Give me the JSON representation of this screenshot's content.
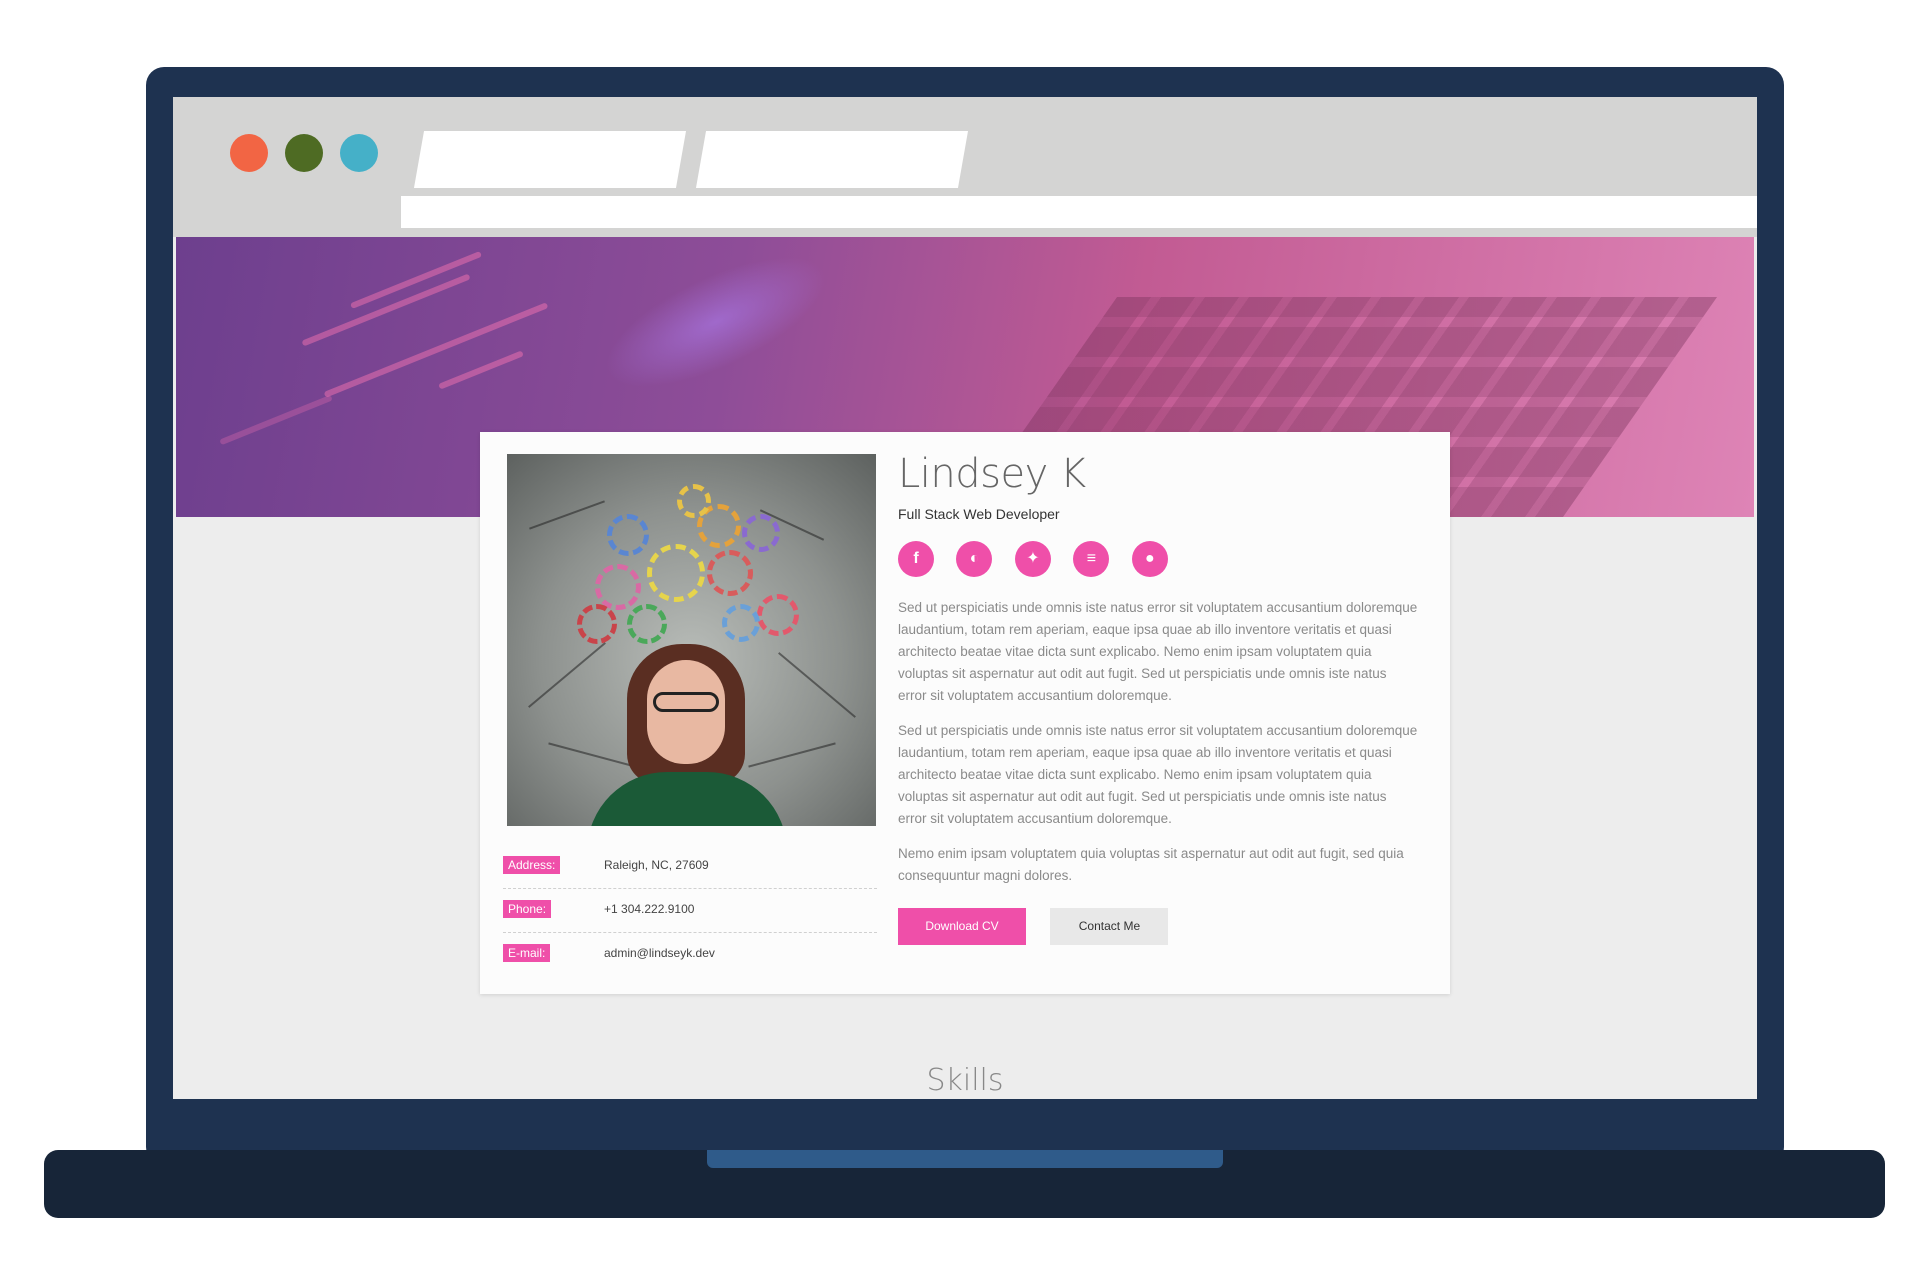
{
  "browser": {
    "window_controls": {
      "close_color": "#f26544",
      "minimize_color": "#4e6b23",
      "maximize_color": "#45b0c8"
    },
    "tabs": [
      "",
      ""
    ],
    "address": ""
  },
  "profile": {
    "name": "Lindsey K",
    "title": "Full Stack Web Developer",
    "photo_icon": "woman-thinking-gears-photo",
    "social_links": [
      {
        "icon": "facebook-icon",
        "glyph": "f"
      },
      {
        "icon": "github-icon",
        "glyph": "◐"
      },
      {
        "icon": "twitter-icon",
        "glyph": "✦"
      },
      {
        "icon": "stackoverflow-icon",
        "glyph": "≡"
      },
      {
        "icon": "medium-icon",
        "glyph": "●"
      }
    ],
    "contact": {
      "address_label": "Address:",
      "address_value": "Raleigh, NC, 27609",
      "phone_label": "Phone:",
      "phone_value": "+1 304.222.9100",
      "email_label": "E-mail:",
      "email_value": "admin@lindseyk.dev"
    },
    "bio": [
      "Sed ut perspiciatis unde omnis iste natus error sit voluptatem accusantium doloremque laudantium, totam rem aperiam, eaque ipsa quae ab illo inventore veritatis et quasi architecto beatae vitae dicta sunt explicabo. Nemo enim ipsam voluptatem quia voluptas sit aspernatur aut odit aut fugit. Sed ut perspiciatis unde omnis iste natus error sit voluptatem accusantium doloremque.",
      "Sed ut perspiciatis unde omnis iste natus error sit voluptatem accusantium doloremque laudantium, totam rem aperiam, eaque ipsa quae ab illo inventore veritatis et quasi architecto beatae vitae dicta sunt explicabo. Nemo enim ipsam voluptatem quia voluptas sit aspernatur aut odit aut fugit. Sed ut perspiciatis unde omnis iste natus error sit voluptatem accusantium doloremque.",
      "Nemo enim ipsam voluptatem quia voluptas sit aspernatur aut odit aut fugit, sed quia consequuntur magni dolores."
    ],
    "buttons": {
      "download_label": "Download CV",
      "contact_label": "Contact Me"
    }
  },
  "sections": {
    "skills_title": "Skills"
  },
  "colors": {
    "accent": "#ef4fa9",
    "laptop_frame": "#1e3250",
    "laptop_base": "#172538",
    "page_background": "#ededed"
  }
}
